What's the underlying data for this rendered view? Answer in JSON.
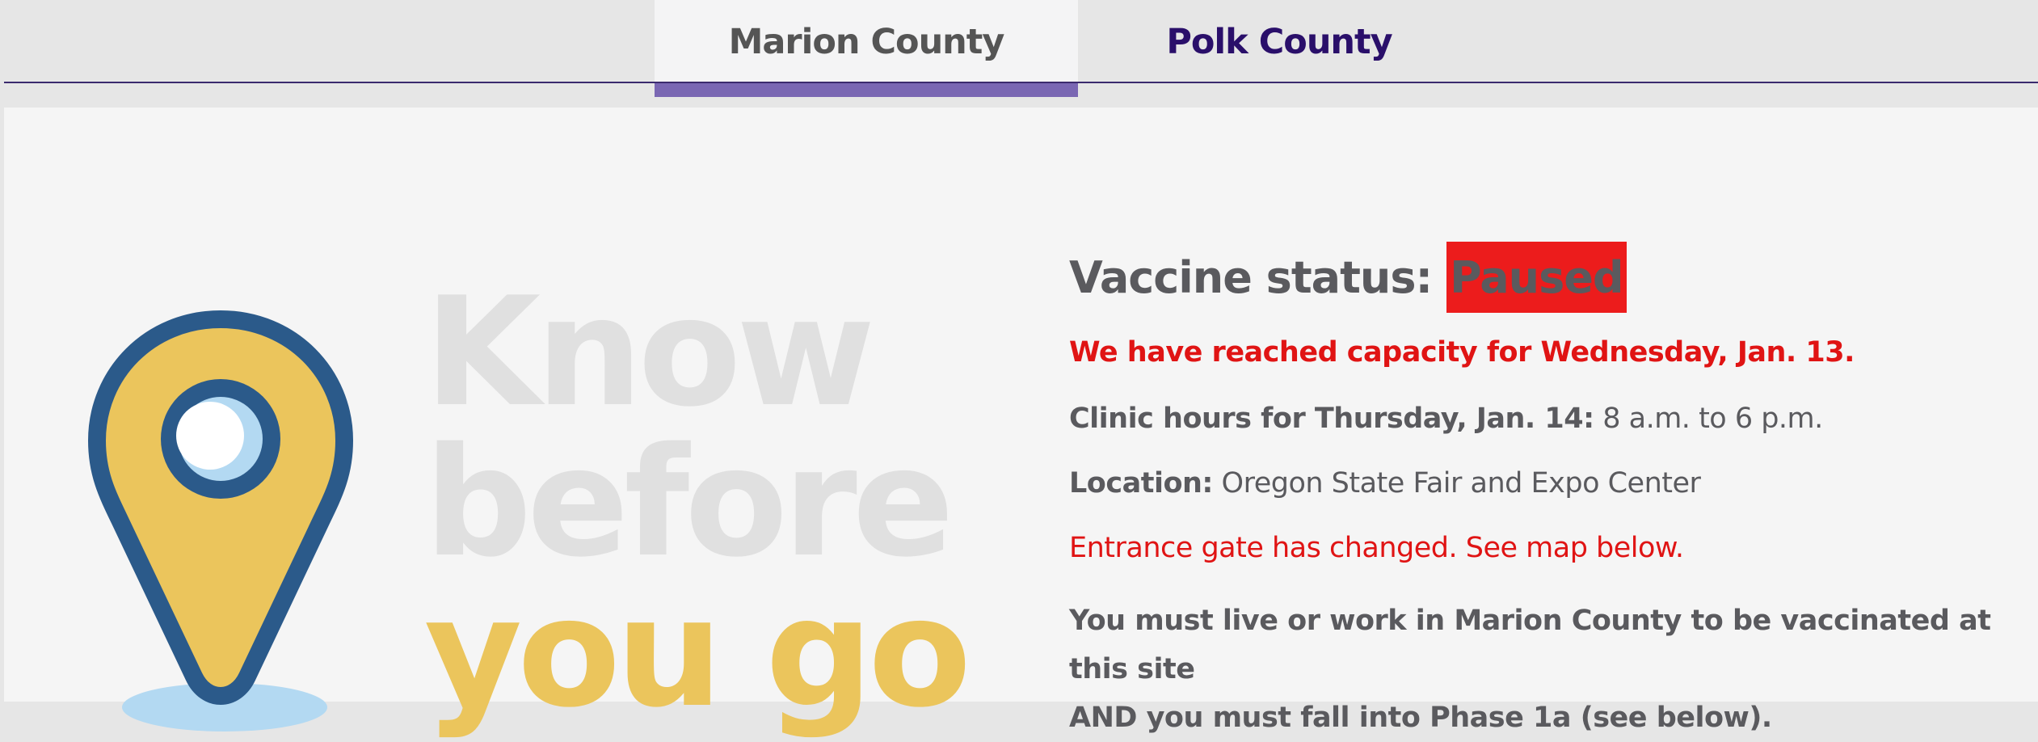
{
  "tabs": [
    {
      "label": "Marion County",
      "active": true
    },
    {
      "label": "Polk County",
      "active": false
    }
  ],
  "colors": {
    "accent": "#7a67b3",
    "tab_inactive_text": "#2a0f6a",
    "alert_red": "#e01414",
    "badge_red": "#ec1c1c",
    "pin_yellow": "#ebc55c",
    "pin_navy": "#2b5a8a",
    "pin_shadow": "#b3d9f2"
  },
  "graphic": {
    "icon": "location-pin-icon",
    "line1": "Know",
    "line2": "before",
    "line3": "you go"
  },
  "info": {
    "status_label": "Vaccine status:",
    "status_value": "Paused",
    "capacity_notice": "We have reached capacity for Wednesday, Jan. 13.",
    "hours_label": "Clinic hours for Thursday, Jan. 14:",
    "hours_value": " 8 a.m. to 6 p.m.",
    "location_label": "Location:",
    "location_value": " Oregon State Fair and Expo Center",
    "gate_notice": "Entrance gate has changed. See map below.",
    "eligibility_line1": "You must live or work in Marion County to be vaccinated at this site",
    "eligibility_line2": "AND you must fall into Phase 1a (see below)."
  }
}
